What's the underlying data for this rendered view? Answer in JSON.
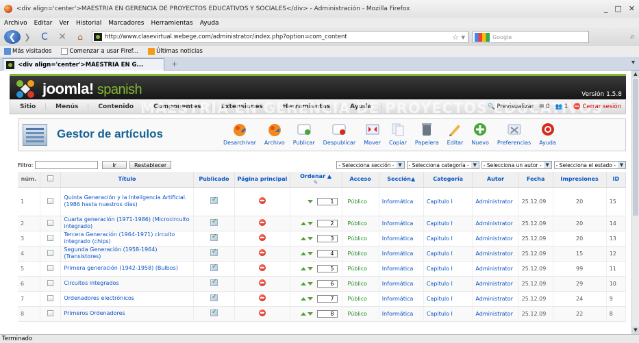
{
  "browser": {
    "window_title": "<div align='center'>MAESTRIA EN GERENCIA DE PROYECTOS EDUCATIVOS Y SOCIALES</div> - Administración - Mozilla Firefox",
    "window_controls": {
      "minimize": "_",
      "maximize": "□",
      "close": "✕"
    },
    "menu": [
      "Archivo",
      "Editar",
      "Ver",
      "Historial",
      "Marcadores",
      "Herramientas",
      "Ayuda"
    ],
    "url": "http://www.clasevirtual.webege.com/administrator/index.php?option=com_content",
    "search_placeholder": "Google",
    "bookmarks": [
      "Más visitados",
      "Comenzar a usar Firef...",
      "Últimas noticias"
    ],
    "tab_title": "<div align='center'>MAESTRIA EN G...",
    "status_text": "Terminado"
  },
  "joomla": {
    "logo_main": "joomla!",
    "logo_sub": "spanish",
    "version": "Versión 1.5.8",
    "menu": [
      "Sitio",
      "Menús",
      "Contenido",
      "Componentes",
      "Extensiones",
      "Herramientas",
      "Ayuda"
    ],
    "menu_ghost_text": "MAESTRIA EN GERENCIA DE PROYECTOS EDUCATIVOS",
    "status": {
      "preview": "Previsualizar",
      "messages": "0",
      "users": "1",
      "logout": "Cerrar sesión"
    },
    "manager_title": "Gestor de artículos",
    "toolbar": [
      {
        "label": "Desarchivar",
        "icon": "unarchive-icon"
      },
      {
        "label": "Archivo",
        "icon": "archive-icon"
      },
      {
        "label": "Publicar",
        "icon": "publish-icon"
      },
      {
        "label": "Despublicar",
        "icon": "unpublish-icon"
      },
      {
        "label": "Mover",
        "icon": "move-icon"
      },
      {
        "label": "Copiar",
        "icon": "copy-icon"
      },
      {
        "label": "Papelera",
        "icon": "trash-icon"
      },
      {
        "label": "Editar",
        "icon": "edit-icon"
      },
      {
        "label": "Nuevo",
        "icon": "new-icon"
      },
      {
        "label": "Preferencias",
        "icon": "preferences-icon"
      },
      {
        "label": "Ayuda",
        "icon": "help-icon"
      }
    ],
    "filter": {
      "label": "Filtro:",
      "value": "",
      "go": "Ir",
      "reset": "Restablecer",
      "selects": [
        "- Selecciona sección -",
        "- Selecciona categoría -",
        "- Selecciona un autor -",
        "- Selecciona el estado -"
      ]
    },
    "table": {
      "headers": {
        "num": "núm.",
        "title": "Título",
        "published": "Publicado",
        "frontpage": "Página principal",
        "order": "Ordenar",
        "access": "Acceso",
        "section": "Sección",
        "category": "Categoría",
        "author": "Autor",
        "date": "Fecha",
        "hits": "Impresiones",
        "id": "ID"
      },
      "rows": [
        {
          "num": "1",
          "title": "Quinta Generación y la Inteligencia Artificial. (1986 hasta nuestros días)",
          "order": "1",
          "access": "Público",
          "section": "Informática",
          "category": "Capitulo I",
          "author": "Administrator",
          "date": "25.12.09",
          "hits": "20",
          "id": "15",
          "up": false
        },
        {
          "num": "2",
          "title": "Cuarta generación (1971-1986) (Microcircuito integrado)",
          "order": "2",
          "access": "Público",
          "section": "Informática",
          "category": "Capitulo I",
          "author": "Administrator",
          "date": "25.12.09",
          "hits": "20",
          "id": "14",
          "up": true
        },
        {
          "num": "3",
          "title": "Tercera Generación (1964-1971) circuito integrado (chips)",
          "order": "3",
          "access": "Público",
          "section": "Informática",
          "category": "Capitulo I",
          "author": "Administrator",
          "date": "25.12.09",
          "hits": "20",
          "id": "13",
          "up": true
        },
        {
          "num": "4",
          "title": "Segunda Generación (1958-1964) (Transistores)",
          "order": "4",
          "access": "Público",
          "section": "Informática",
          "category": "Capitulo I",
          "author": "Administrator",
          "date": "25.12.09",
          "hits": "15",
          "id": "12",
          "up": true
        },
        {
          "num": "5",
          "title": "Primera generación (1942-1958) (Bulbos)",
          "order": "5",
          "access": "Público",
          "section": "Informática",
          "category": "Capitulo I",
          "author": "Administrator",
          "date": "25.12.09",
          "hits": "99",
          "id": "11",
          "up": true
        },
        {
          "num": "6",
          "title": "Circuitos integrados",
          "order": "6",
          "access": "Público",
          "section": "Informática",
          "category": "Capitulo I",
          "author": "Administrator",
          "date": "25.12.09",
          "hits": "29",
          "id": "10",
          "up": true
        },
        {
          "num": "7",
          "title": "Ordenadores electrónicos",
          "order": "7",
          "access": "Público",
          "section": "Informática",
          "category": "Capitulo I",
          "author": "Administrator",
          "date": "25.12.09",
          "hits": "24",
          "id": "9",
          "up": true
        },
        {
          "num": "8",
          "title": "Primeros Ordenadores",
          "order": "8",
          "access": "Público",
          "section": "Informática",
          "category": "Capitulo I",
          "author": "Administrator",
          "date": "25.12.09",
          "hits": "22",
          "id": "8",
          "up": true
        }
      ]
    }
  },
  "colors": {
    "joomla_green": "#84b934",
    "link_blue": "#0b55c4",
    "title_blue": "#146295",
    "access_green": "#1f8b1f"
  }
}
